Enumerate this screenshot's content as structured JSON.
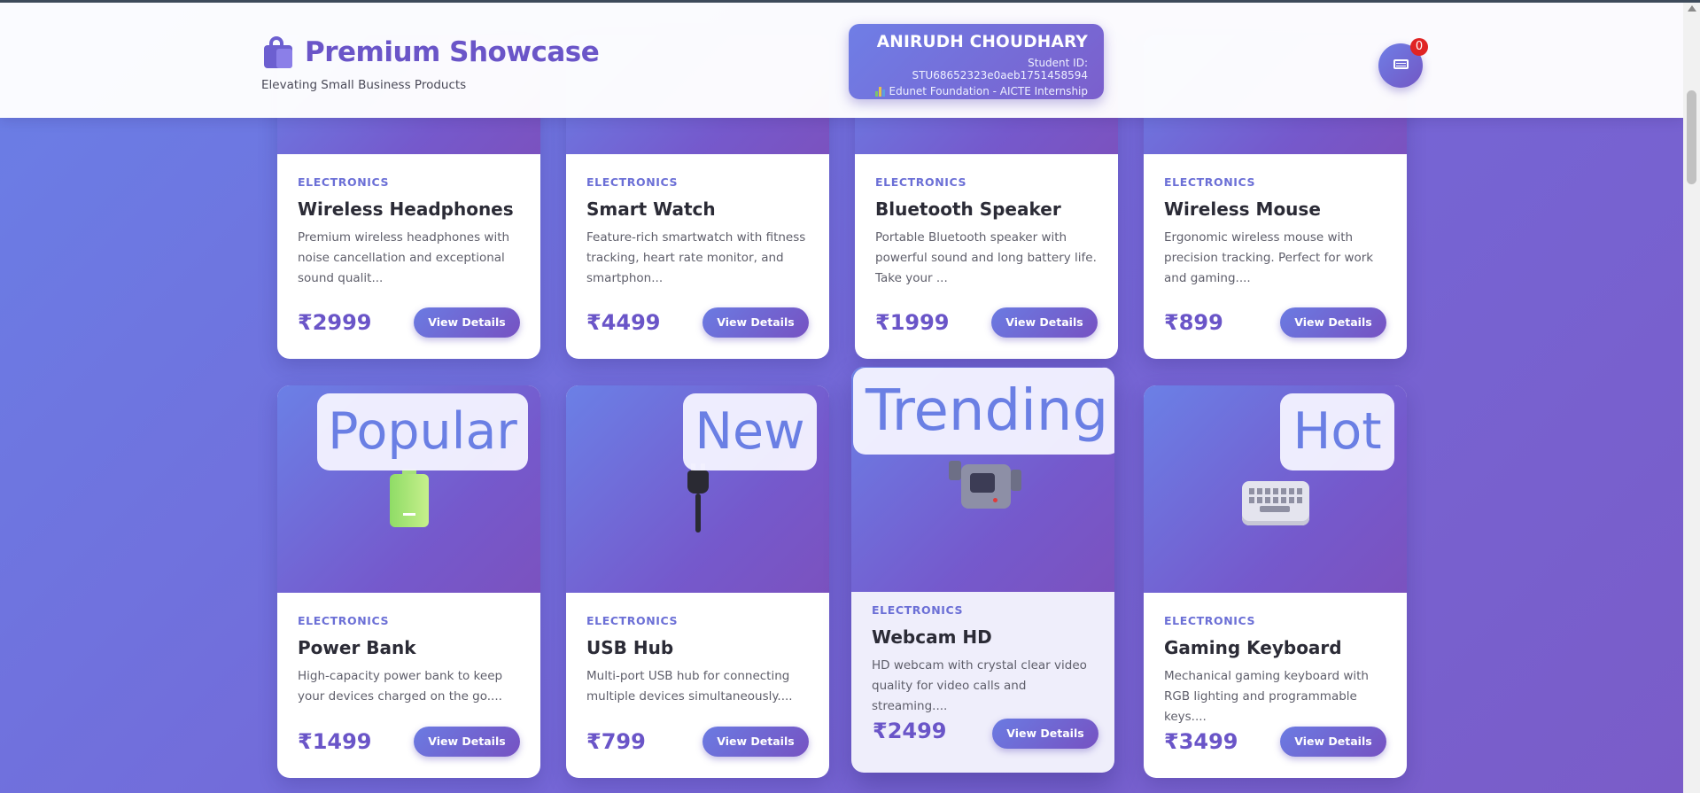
{
  "header": {
    "brand_title": "Premium Showcase",
    "tagline": "Elevating Small Business Products",
    "student": {
      "name": "ANIRUDH CHOUDHARY",
      "id_line": "Student ID: STU68652323e0aeb1751458594",
      "org_line": "Edunet Foundation - AICTE Internship"
    },
    "cart_count": "0"
  },
  "colors": {
    "accent": "#6a55c8",
    "gradient_start": "#6a7fe6",
    "gradient_end": "#7a5cc8",
    "badge_red": "#e02424"
  },
  "products": [
    {
      "category": "ELECTRONICS",
      "name": "Wireless Headphones",
      "description": "Premium wireless headphones with noise cancellation and exceptional sound qualit...",
      "price": "₹2999",
      "button": "View Details"
    },
    {
      "category": "ELECTRONICS",
      "name": "Smart Watch",
      "description": "Feature-rich smartwatch with fitness tracking, heart rate monitor, and smartphon...",
      "price": "₹4499",
      "button": "View Details"
    },
    {
      "category": "ELECTRONICS",
      "name": "Bluetooth Speaker",
      "description": "Portable Bluetooth speaker with powerful sound and long battery life. Take your ...",
      "price": "₹1999",
      "button": "View Details"
    },
    {
      "category": "ELECTRONICS",
      "name": "Wireless Mouse",
      "description": "Ergonomic wireless mouse with precision tracking. Perfect for work and gaming....",
      "price": "₹899",
      "button": "View Details"
    },
    {
      "category": "ELECTRONICS",
      "name": "Power Bank",
      "description": "High-capacity power bank to keep your devices charged on the go....",
      "price": "₹1499",
      "button": "View Details",
      "badge": "Popular",
      "icon": "battery-icon"
    },
    {
      "category": "ELECTRONICS",
      "name": "USB Hub",
      "description": "Multi-port USB hub for connecting multiple devices simultaneously....",
      "price": "₹799",
      "button": "View Details",
      "badge": "New",
      "icon": "plug-icon"
    },
    {
      "category": "ELECTRONICS",
      "name": "Webcam HD",
      "description": "HD webcam with crystal clear video quality for video calls and streaming....",
      "price": "₹2499",
      "button": "View Details",
      "badge": "Trending",
      "icon": "camera-icon"
    },
    {
      "category": "ELECTRONICS",
      "name": "Gaming Keyboard",
      "description": "Mechanical gaming keyboard with RGB lighting and programmable keys....",
      "price": "₹3499",
      "button": "View Details",
      "badge": "Hot",
      "icon": "keyboard-icon"
    }
  ]
}
